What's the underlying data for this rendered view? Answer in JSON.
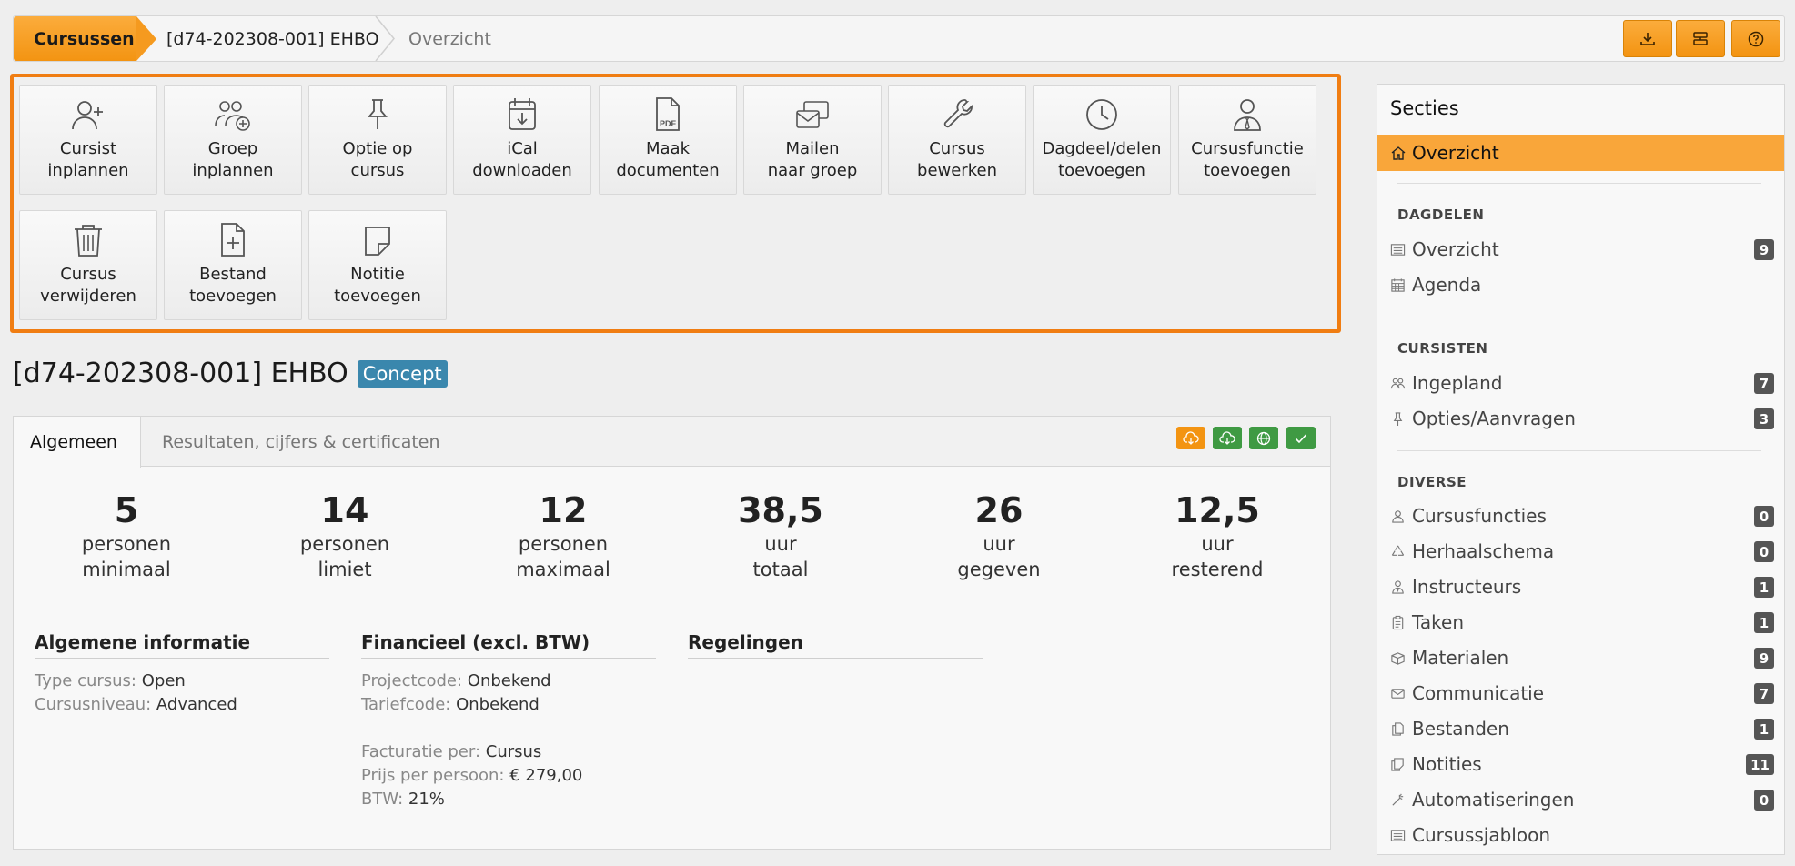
{
  "breadcrumb": {
    "home": "Cursussen",
    "course": "[d74-202308-001] EHBO",
    "current": "Overzicht"
  },
  "toolbar_icons": [
    "download-icon",
    "layout-icon",
    "help-icon"
  ],
  "actions": [
    {
      "label": "Cursist\ninplannen",
      "icon": "user-plus-icon"
    },
    {
      "label": "Groep\ninplannen",
      "icon": "group-plus-icon"
    },
    {
      "label": "Optie op\ncursus",
      "icon": "pin-icon"
    },
    {
      "label": "iCal\ndownloaden",
      "icon": "calendar-download-icon"
    },
    {
      "label": "Maak\ndocumenten",
      "icon": "pdf-icon"
    },
    {
      "label": "Mailen\nnaar groep",
      "icon": "mail-group-icon"
    },
    {
      "label": "Cursus\nbewerken",
      "icon": "wrench-icon"
    },
    {
      "label": "Dagdeel/delen\ntoevoegen",
      "icon": "clock-icon"
    },
    {
      "label": "Cursusfunctie\ntoevoegen",
      "icon": "user-tie-icon"
    },
    {
      "label": "Cursus\nverwijderen",
      "icon": "trash-icon"
    },
    {
      "label": "Bestand\ntoevoegen",
      "icon": "file-plus-icon"
    },
    {
      "label": "Notitie\ntoevoegen",
      "icon": "note-icon"
    }
  ],
  "course": {
    "title": "[d74-202308-001] EHBO",
    "status": "Concept"
  },
  "tabs": {
    "general": "Algemeen",
    "results": "Resultaten, cijfers & certificaten"
  },
  "tab_buttons": [
    {
      "icon": "cloud-download-icon",
      "color": "#f39412"
    },
    {
      "icon": "cloud-download-icon",
      "color": "#3f9a43"
    },
    {
      "icon": "globe-icon",
      "color": "#3f9a43"
    },
    {
      "icon": "check-icon",
      "color": "#3f9a43"
    }
  ],
  "stats": [
    {
      "value": "5",
      "line1": "personen",
      "line2": "minimaal"
    },
    {
      "value": "14",
      "line1": "personen",
      "line2": "limiet"
    },
    {
      "value": "12",
      "line1": "personen",
      "line2": "maximaal"
    },
    {
      "value": "38,5",
      "line1": "uur",
      "line2": "totaal"
    },
    {
      "value": "26",
      "line1": "uur",
      "line2": "gegeven"
    },
    {
      "value": "12,5",
      "line1": "uur",
      "line2": "resterend"
    }
  ],
  "general_info": {
    "heading": "Algemene informatie",
    "type_key": "Type cursus:",
    "type_val": "Open",
    "level_key": "Cursusniveau:",
    "level_val": "Advanced"
  },
  "financial": {
    "heading": "Financieel (excl. BTW)",
    "project_key": "Projectcode:",
    "project_val": "Onbekend",
    "tariff_key": "Tariefcode:",
    "tariff_val": "Onbekend",
    "invoice_key": "Facturatie per:",
    "invoice_val": "Cursus",
    "price_key": "Prijs per persoon:",
    "price_val": "€ 279,00",
    "vat_key": "BTW:",
    "vat_val": "21%"
  },
  "arrangements": {
    "heading": "Regelingen"
  },
  "sidebar": {
    "title": "Secties",
    "active": "Overzicht",
    "groups": [
      {
        "label": "DAGDELEN",
        "items": [
          {
            "label": "Overzicht",
            "count": "9",
            "icon": "list-icon"
          },
          {
            "label": "Agenda",
            "count": "",
            "icon": "calendar-icon"
          }
        ]
      },
      {
        "label": "CURSISTEN",
        "items": [
          {
            "label": "Ingepland",
            "count": "7",
            "icon": "users-icon"
          },
          {
            "label": "Opties/Aanvragen",
            "count": "3",
            "icon": "pin-icon"
          }
        ]
      },
      {
        "label": "DIVERSE",
        "items": [
          {
            "label": "Cursusfuncties",
            "count": "0",
            "icon": "user-icon"
          },
          {
            "label": "Herhaalschema",
            "count": "0",
            "icon": "recycle-icon"
          },
          {
            "label": "Instructeurs",
            "count": "1",
            "icon": "instructor-icon"
          },
          {
            "label": "Taken",
            "count": "1",
            "icon": "clipboard-icon"
          },
          {
            "label": "Materialen",
            "count": "9",
            "icon": "box-icon"
          },
          {
            "label": "Communicatie",
            "count": "7",
            "icon": "envelope-icon"
          },
          {
            "label": "Bestanden",
            "count": "1",
            "icon": "files-icon"
          },
          {
            "label": "Notities",
            "count": "11",
            "icon": "notes-icon"
          },
          {
            "label": "Automatiseringen",
            "count": "0",
            "icon": "magic-icon"
          },
          {
            "label": "Cursussjabloon",
            "count": "",
            "icon": "list-icon"
          }
        ]
      }
    ]
  }
}
